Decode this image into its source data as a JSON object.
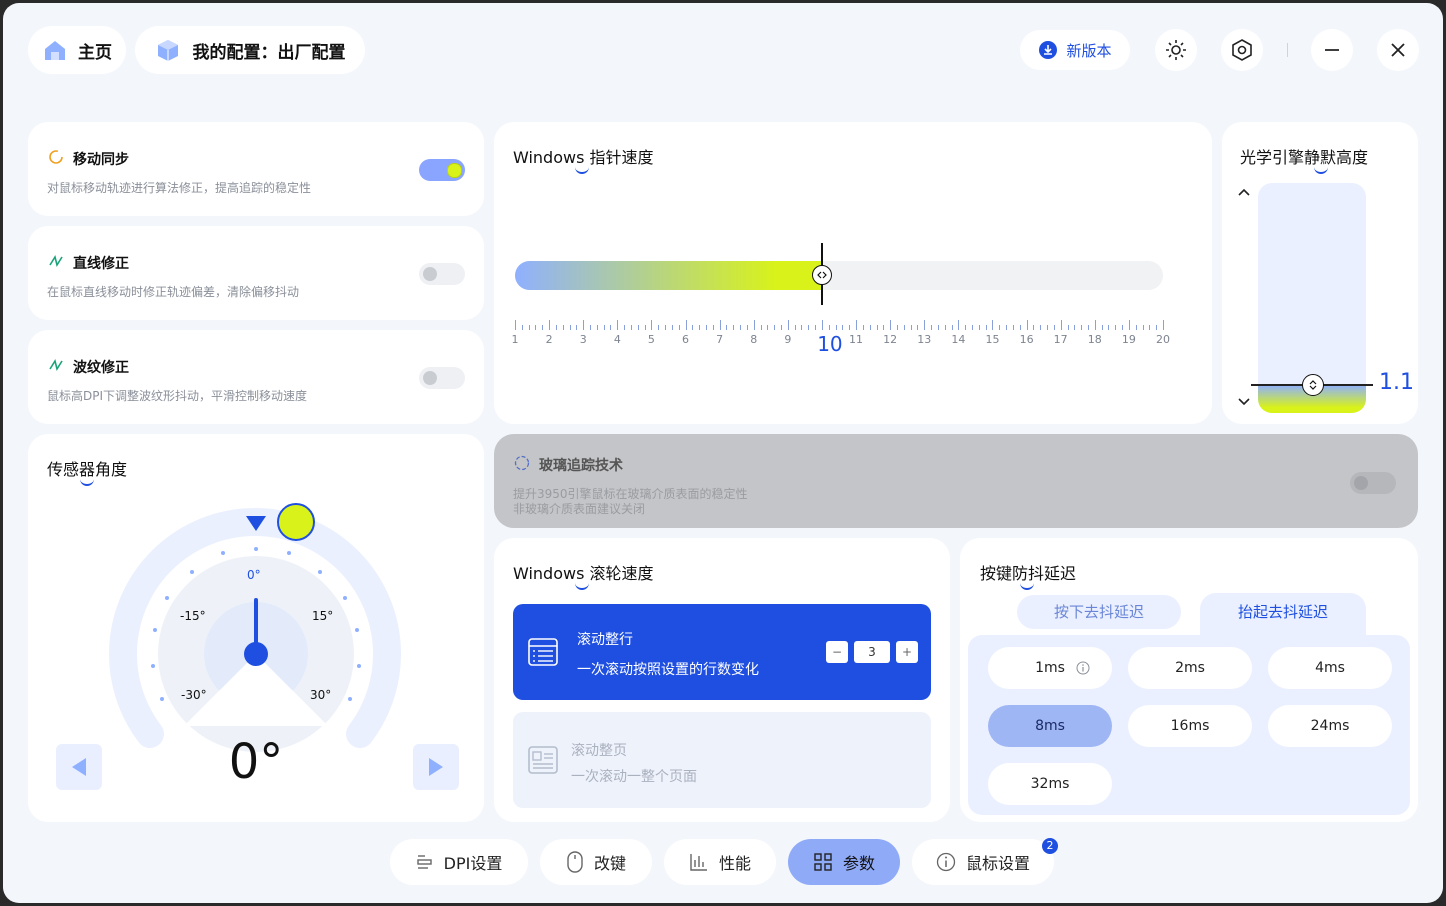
{
  "header": {
    "home_label": "主页",
    "config_label": "我的配置：出厂配置",
    "new_version_label": "新版本"
  },
  "motion_sync": {
    "title": "移动同步",
    "desc": "对鼠标移动轨迹进行算法修正，提高追踪的稳定性",
    "enabled": true
  },
  "line_correction": {
    "title": "直线修正",
    "desc": "在鼠标直线移动时修正轨迹偏差，清除偏移抖动",
    "enabled": false
  },
  "ripple_correction": {
    "title": "波纹修正",
    "desc": "鼠标高DPI下调整波纹形抖动，平滑控制移动速度",
    "enabled": false
  },
  "pointer_speed": {
    "title": "Windows 指针速度",
    "min": 1,
    "max": 20,
    "value": 10,
    "tick_labels": [
      "1",
      "2",
      "3",
      "4",
      "5",
      "6",
      "7",
      "8",
      "9",
      "10",
      "11",
      "12",
      "13",
      "14",
      "15",
      "16",
      "17",
      "18",
      "19",
      "20"
    ],
    "value_label": "10"
  },
  "lift_off": {
    "title": "光学引擎静默高度",
    "value_label": "1.1",
    "value_fraction": 0.88
  },
  "sensor_angle": {
    "title": "传感器角度",
    "labels": {
      "zero": "0°",
      "m15": "-15°",
      "p15": "15°",
      "m30": "-30°",
      "p30": "30°"
    },
    "value_label": "0°"
  },
  "glass_tracking": {
    "title": "玻璃追踪技术",
    "desc1": "提升3950引擎鼠标在玻璃介质表面的稳定性",
    "desc2": "非玻璃介质表面建议关闭",
    "enabled": false
  },
  "scroll_speed": {
    "title": "Windows 滚轮速度",
    "line_mode": {
      "title": "滚动整行",
      "desc": "一次滚动按照设置的行数变化",
      "value": "3",
      "minus": "−",
      "plus": "+"
    },
    "page_mode": {
      "title": "滚动整页",
      "desc": "一次滚动一整个页面"
    }
  },
  "debounce": {
    "title": "按键防抖延迟",
    "tabs": [
      "按下去抖延迟",
      "抬起去抖延迟"
    ],
    "options": [
      "1ms",
      "2ms",
      "4ms",
      "8ms",
      "16ms",
      "24ms",
      "32ms"
    ],
    "selected": "8ms"
  },
  "nav": {
    "dpi": "DPI设置",
    "keys": "改键",
    "perf": "性能",
    "params": "参数",
    "mouse": "鼠标设置",
    "mouse_badge": "2"
  },
  "colors": {
    "accent": "#1f4fe0",
    "lime": "#d8f21a",
    "selected_bg": "#9fb6f4"
  }
}
